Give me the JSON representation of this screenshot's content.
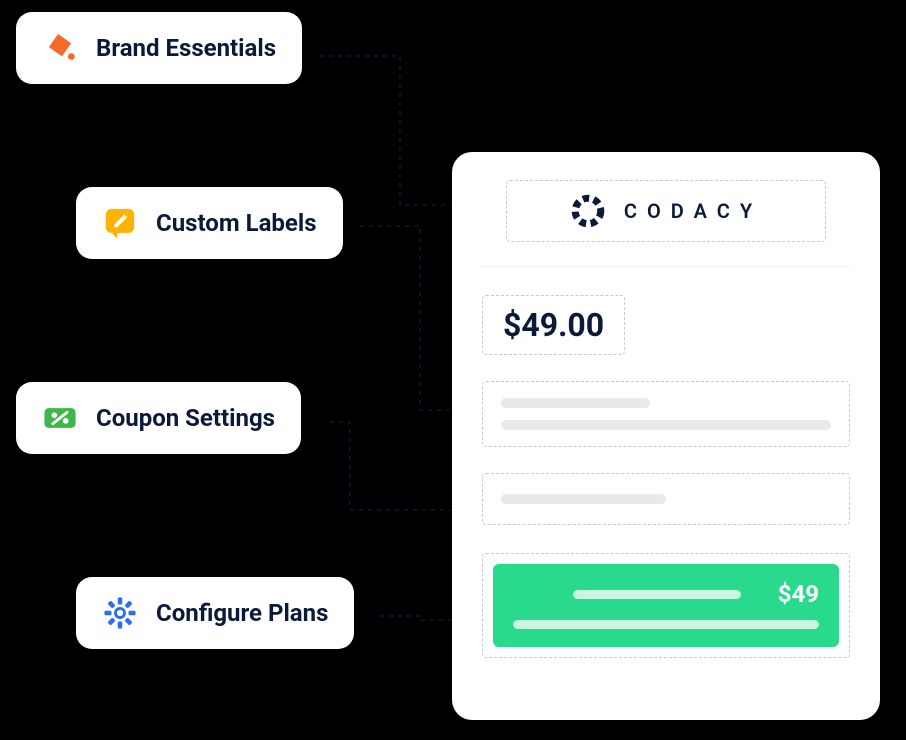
{
  "cards": {
    "brand": {
      "label": "Brand Essentials"
    },
    "labels": {
      "label": "Custom Labels"
    },
    "coupon": {
      "label": "Coupon Settings"
    },
    "plans": {
      "label": "Configure Plans"
    }
  },
  "panel": {
    "brand_name": "CODACY",
    "price_display": "$49.00",
    "cta_price": "$49"
  },
  "colors": {
    "brand_orange": "#f36a2b",
    "label_yellow": "#ffb300",
    "coupon_green": "#3fb648",
    "plan_blue": "#2f6def",
    "cta_green": "#29d98c",
    "ink": "#0b1a3a"
  }
}
